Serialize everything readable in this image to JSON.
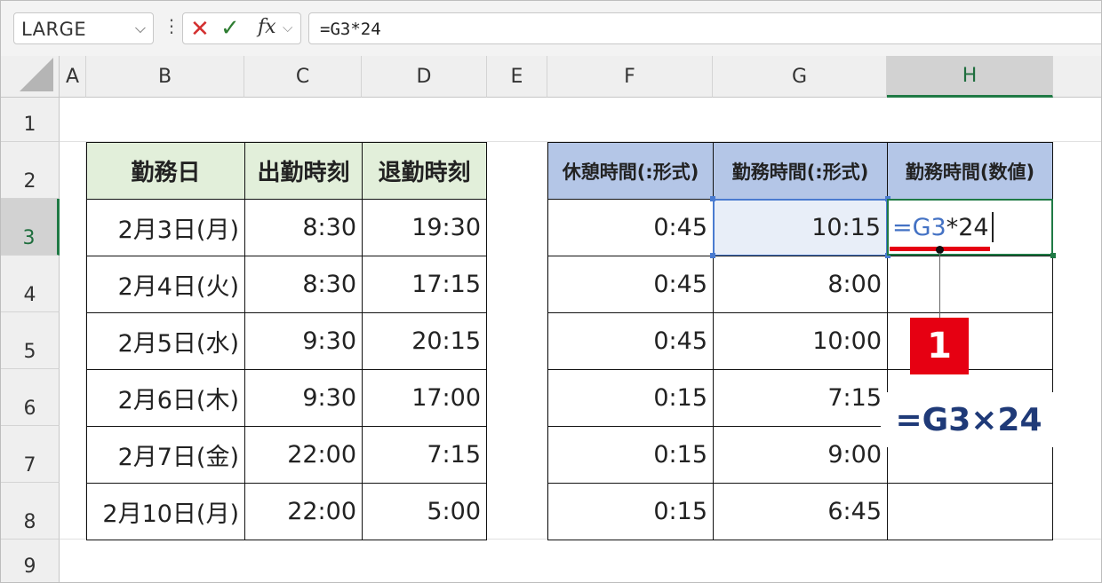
{
  "name_box": {
    "value": "LARGE"
  },
  "formula_bar": {
    "cancel_glyph": "✕",
    "enter_glyph": "✓",
    "fx_label": "fx",
    "formula": "=G3*24"
  },
  "columns": [
    "A",
    "B",
    "C",
    "D",
    "E",
    "F",
    "G",
    "H"
  ],
  "rows": [
    "1",
    "2",
    "3",
    "4",
    "5",
    "6",
    "7",
    "8",
    "9"
  ],
  "left_table": {
    "headers": [
      "勤務日",
      "出勤時刻",
      "退勤時刻"
    ],
    "rows": [
      [
        "2月3日(月)",
        "8:30",
        "19:30"
      ],
      [
        "2月4日(火)",
        "8:30",
        "17:15"
      ],
      [
        "2月5日(水)",
        "9:30",
        "20:15"
      ],
      [
        "2月6日(木)",
        "9:30",
        "17:00"
      ],
      [
        "2月7日(金)",
        "22:00",
        "7:15"
      ],
      [
        "2月10日(月)",
        "22:00",
        "5:00"
      ]
    ]
  },
  "right_table": {
    "headers": [
      "休憩時間(:形式)",
      "勤務時間(:形式)",
      "勤務時間(数値)"
    ],
    "rows": [
      [
        "0:45",
        "10:15",
        ""
      ],
      [
        "0:45",
        "8:00",
        ""
      ],
      [
        "0:45",
        "10:00",
        ""
      ],
      [
        "0:15",
        "7:15",
        ""
      ],
      [
        "0:15",
        "9:00",
        ""
      ],
      [
        "0:15",
        "6:45",
        ""
      ]
    ]
  },
  "editing_cell": {
    "address": "H3",
    "eq": "=",
    "ref": "G3",
    "rest": "*24"
  },
  "annotation": {
    "badge": "1",
    "callout": "=G3×24"
  },
  "colors": {
    "accent_green": "#1f7a45",
    "header_green": "#e2efda",
    "header_blue": "#b4c6e7",
    "badge_red": "#e60012",
    "ref_blue": "#4472c4"
  }
}
